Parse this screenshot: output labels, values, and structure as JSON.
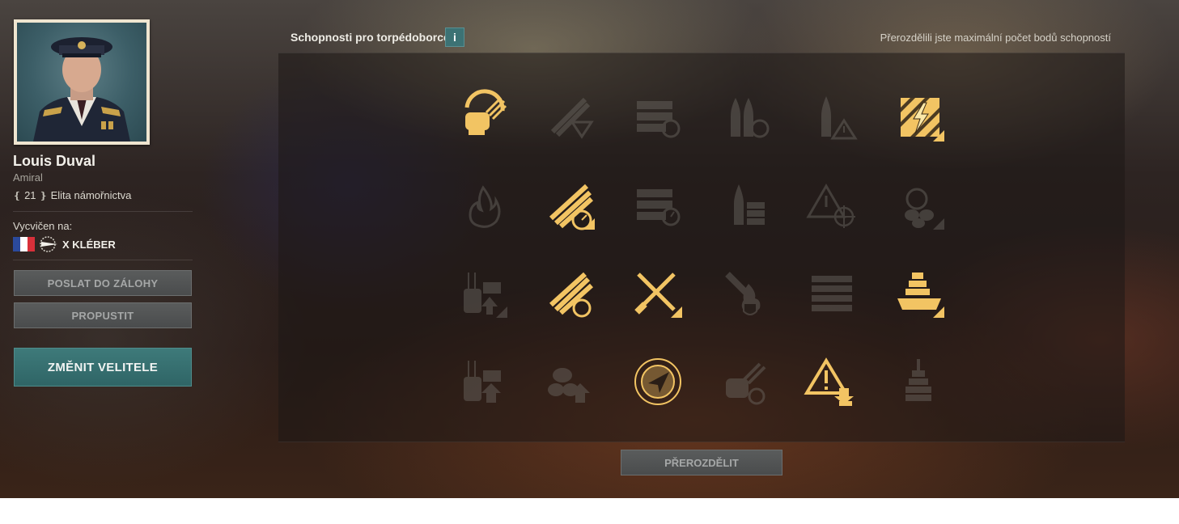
{
  "commander": {
    "name": "Louis Duval",
    "rank": "Amiral",
    "level": "21",
    "level_label": "Elita námořnictva",
    "trained_label": "Vycvičen na:",
    "ship": "X KLÉBER"
  },
  "buttons": {
    "reserve": "POSLAT DO ZÁLOHY",
    "dismiss": "PROPUSTIT",
    "change": "ZMĚNIT VELITELE",
    "redistribute": "PŘEROZDĚLIT"
  },
  "skills_panel": {
    "title": "Schopnosti pro torpédoborce",
    "info_label": "i",
    "note": "Přerozdělili jste maximální počet bodů schopností",
    "rows": [
      [
        {
          "icon": "gun-reload-icon",
          "active": true
        },
        {
          "icon": "torpedo-acceleration-icon",
          "active": false
        },
        {
          "icon": "ammo-reload-icon",
          "active": false
        },
        {
          "icon": "shells-reload-icon",
          "active": false
        },
        {
          "icon": "shell-warning-icon",
          "active": false
        },
        {
          "icon": "emergency-repair-icon",
          "active": true
        }
      ],
      [
        {
          "icon": "fire-icon",
          "active": false
        },
        {
          "icon": "torpedo-speed-icon",
          "active": true
        },
        {
          "icon": "launcher-timer-icon",
          "active": false
        },
        {
          "icon": "shell-stack-icon",
          "active": false
        },
        {
          "icon": "warning-target-icon",
          "active": false
        },
        {
          "icon": "helm-propeller-icon",
          "active": false
        }
      ],
      [
        {
          "icon": "secondary-battery-upgrade-icon",
          "active": false
        },
        {
          "icon": "torpedo-reload-icon",
          "active": true
        },
        {
          "icon": "crossed-guns-icon",
          "active": true
        },
        {
          "icon": "fire-shield-icon",
          "active": false
        },
        {
          "icon": "torpedo-rack-icon",
          "active": false
        },
        {
          "icon": "ship-upgrade-icon",
          "active": true
        }
      ],
      [
        {
          "icon": "battery-upgrade-icon",
          "active": false
        },
        {
          "icon": "propeller-upgrade-icon",
          "active": false
        },
        {
          "icon": "radar-compass-icon",
          "active": true
        },
        {
          "icon": "gun-reload-alt-icon",
          "active": false
        },
        {
          "icon": "warning-down-icon",
          "active": true
        },
        {
          "icon": "ship-silhouette-icon",
          "active": false
        }
      ]
    ]
  },
  "colors": {
    "active": "#f2c463",
    "inactive": "#6e6a64",
    "accent": "#3c7274"
  }
}
